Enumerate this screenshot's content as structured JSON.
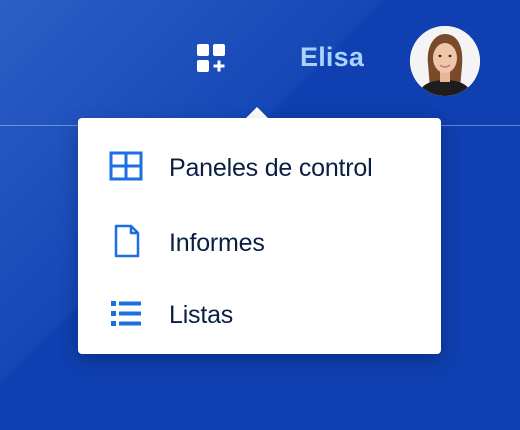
{
  "header": {
    "add_widget_icon": "grid-plus-icon",
    "username": "Elisa",
    "avatar_icon": "user-avatar"
  },
  "menu": {
    "items": [
      {
        "label": "Paneles de control",
        "icon": "dashboard-grid-icon"
      },
      {
        "label": "Informes",
        "icon": "document-icon"
      },
      {
        "label": "Listas",
        "icon": "list-icon"
      }
    ]
  },
  "colors": {
    "background": "#0f3fb0",
    "username": "#a9d2ff",
    "icon_accent": "#1c6fe0",
    "menu_text": "#0a1f44"
  }
}
